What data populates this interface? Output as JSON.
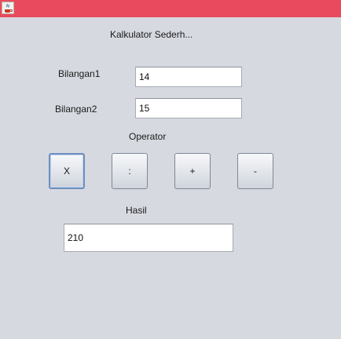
{
  "window": {
    "icon": "java-coffee-icon"
  },
  "labels": {
    "title": "Kalkulator Sederh...",
    "bilangan1": "Bilangan1",
    "bilangan2": "Bilangan2",
    "operator": "Operator",
    "hasil": "Hasil"
  },
  "fields": {
    "bilangan1_value": "14",
    "bilangan2_value": "15",
    "hasil_value": "210"
  },
  "buttons": {
    "multiply": "X",
    "divide": ":",
    "add": "+",
    "subtract": "-"
  },
  "colors": {
    "titlebar": "#ea4a5e",
    "background": "#d6d9e0",
    "focus_border": "#6d8ec0"
  }
}
